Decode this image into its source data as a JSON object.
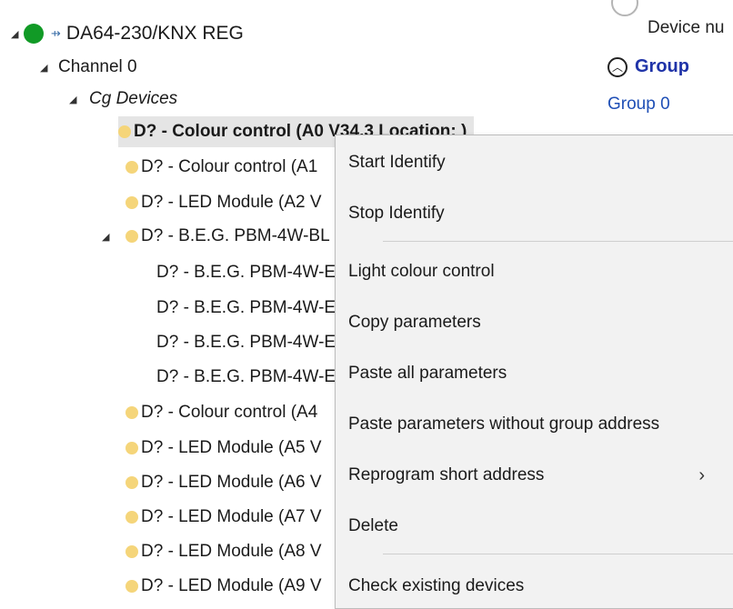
{
  "tree": {
    "root": {
      "label": "DA64-230/KNX REG",
      "status_color": "#119a26"
    },
    "channel": {
      "label": "Channel 0"
    },
    "group": {
      "label": "Cg Devices"
    },
    "devices": [
      {
        "label": "D? - Colour control (A0 V34.3 Location: )",
        "selected": true
      },
      {
        "label": "D? - Colour control (A1"
      },
      {
        "label": "D? - LED Module (A2 V"
      },
      {
        "label": "D? - B.E.G. PBM-4W-BL",
        "expanded": true
      },
      {
        "label": "D? - B.E.G. PBM-4W-E",
        "child": true
      },
      {
        "label": "D? - B.E.G. PBM-4W-E",
        "child": true
      },
      {
        "label": "D? - B.E.G. PBM-4W-E",
        "child": true
      },
      {
        "label": "D? - B.E.G. PBM-4W-E",
        "child": true
      },
      {
        "label": "D? - Colour control (A4"
      },
      {
        "label": "D? - LED Module (A5 V"
      },
      {
        "label": "D? - LED Module (A6 V"
      },
      {
        "label": "D? - LED Module (A7 V"
      },
      {
        "label": "D? - LED Module (A8 V"
      },
      {
        "label": "D? - LED Module (A9 V"
      }
    ]
  },
  "right_pane": {
    "device_number_label": "Device nu",
    "group_section": {
      "title": "Group",
      "item": "Group 0"
    }
  },
  "context_menu": {
    "items": [
      {
        "label": "Start Identify"
      },
      {
        "label": "Stop Identify"
      },
      {
        "label": "Light colour control"
      },
      {
        "label": "Copy parameters"
      },
      {
        "label": "Paste all parameters"
      },
      {
        "label": "Paste parameters without group address"
      },
      {
        "label": "Reprogram short address",
        "has_submenu": true
      },
      {
        "label": "Delete"
      },
      {
        "label": "Check existing devices"
      }
    ],
    "submenu_arrow": "›"
  },
  "colors": {
    "device_dot": "#f5d57a",
    "group_title": "#1f33a8",
    "selection_bg": "#e5e5e5"
  }
}
